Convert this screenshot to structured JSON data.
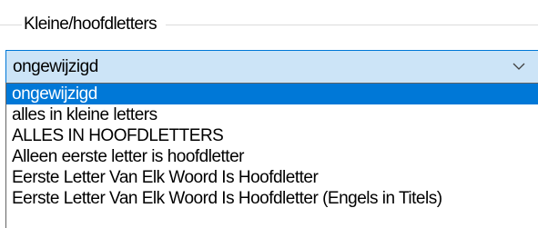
{
  "group": {
    "title": "Kleine/hoofdletters"
  },
  "combo": {
    "value": "ongewijzigd",
    "arrow_icon": "chevron-down-icon"
  },
  "dropdown": {
    "selected_index": 0,
    "items": [
      "ongewijzigd",
      "alles in kleine letters",
      "ALLES IN HOOFDLETTERS",
      "Alleen eerste letter is hoofdletter",
      "Eerste Letter Van Elk Woord Is Hoofdletter",
      "Eerste Letter Van Elk Woord Is Hoofdletter (Engels in Titels)"
    ]
  },
  "colors": {
    "selection_background": "#0078d7",
    "selection_text": "#ffffff",
    "combo_background": "#cce4f7",
    "combo_border": "#0078d7"
  }
}
